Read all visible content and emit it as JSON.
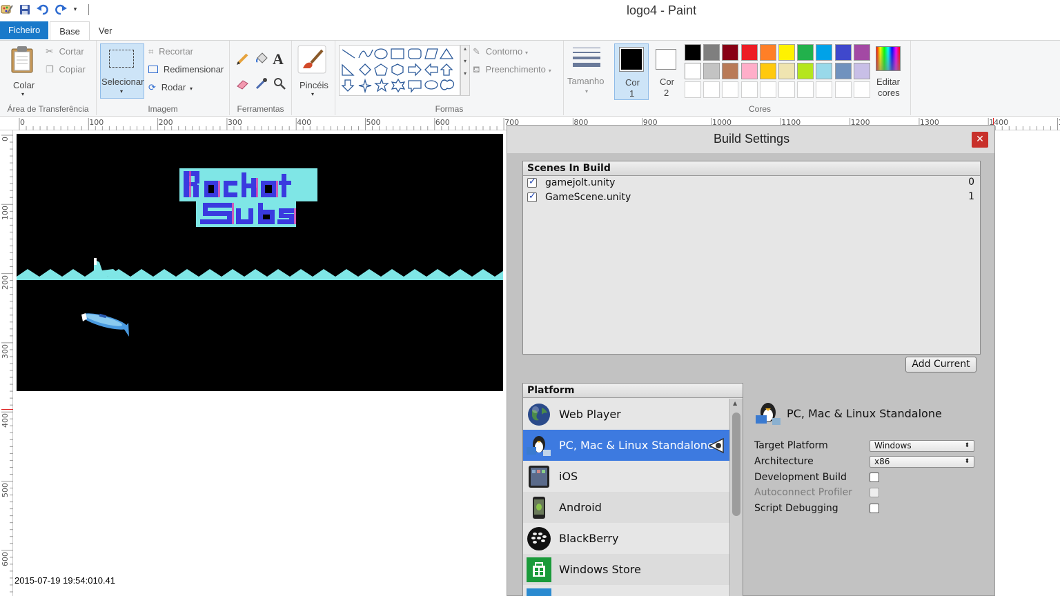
{
  "window": {
    "title": "logo4 - Paint"
  },
  "tabs": {
    "file": "Ficheiro",
    "home": "Base",
    "view": "Ver"
  },
  "ribbon": {
    "clipboard": {
      "paste": "Colar",
      "cut": "Cortar",
      "copy": "Copiar",
      "label": "Área de Transferência"
    },
    "image": {
      "select": "Selecionar",
      "crop": "Recortar",
      "resize": "Redimensionar",
      "rotate": "Rodar",
      "label": "Imagem"
    },
    "tools": {
      "label": "Ferramentas"
    },
    "brushes": {
      "label": "Pincéis"
    },
    "shapes": {
      "outline": "Contorno",
      "fill": "Preenchimento",
      "label": "Formas"
    },
    "size": {
      "label": "Tamanho"
    },
    "color1": {
      "label": "Cor",
      "num": "1",
      "value": "#000000"
    },
    "color2": {
      "label": "Cor",
      "num": "2",
      "value": "#ffffff"
    },
    "colors": {
      "label": "Cores",
      "row1": [
        "#000000",
        "#7f7f7f",
        "#880015",
        "#ed1c24",
        "#ff7f27",
        "#fff200",
        "#22b14c",
        "#00a2e8",
        "#3f48cc",
        "#a349a4"
      ],
      "row2": [
        "#ffffff",
        "#c3c3c3",
        "#b97a57",
        "#ffaec9",
        "#ffc90e",
        "#efe4b0",
        "#b5e61d",
        "#99d9ea",
        "#7092be",
        "#c8bfe7"
      ]
    },
    "edit_colors": {
      "line1": "Editar",
      "line2": "cores"
    }
  },
  "ruler": {
    "h": [
      "0",
      "100",
      "200",
      "300",
      "400",
      "500",
      "600",
      "700",
      "800",
      "900",
      "1000",
      "1100",
      "1200",
      "1300",
      "1400",
      "15"
    ],
    "v": [
      "0",
      "100",
      "200",
      "300",
      "400",
      "500",
      "600"
    ]
  },
  "canvas": {
    "timestamp": "2015-07-19 19:54:010.41"
  },
  "build_settings": {
    "title": "Build Settings",
    "close": "✕",
    "scenes_header": "Scenes In Build",
    "scenes": [
      {
        "name": "gamejolt.unity",
        "index": "0",
        "checked": true
      },
      {
        "name": "GameScene.unity",
        "index": "1",
        "checked": true
      }
    ],
    "add_current": "Add Current",
    "platform_header": "Platform",
    "platforms": [
      {
        "name": "Web Player",
        "icon": "globe-icon",
        "selected": false
      },
      {
        "name": "PC, Mac & Linux Standalone",
        "icon": "penguin-icon",
        "selected": true
      },
      {
        "name": "iOS",
        "icon": "ipad-icon",
        "selected": false
      },
      {
        "name": "Android",
        "icon": "android-phone-icon",
        "selected": false
      },
      {
        "name": "BlackBerry",
        "icon": "blackberry-icon",
        "selected": false
      },
      {
        "name": "Windows Store",
        "icon": "windows-store-icon",
        "selected": false
      }
    ],
    "details": {
      "title": "PC, Mac & Linux Standalone",
      "target_platform_label": "Target Platform",
      "target_platform_value": "Windows",
      "architecture_label": "Architecture",
      "architecture_value": "x86",
      "development_build_label": "Development Build",
      "autoconnect_profiler_label": "Autoconnect Profiler",
      "script_debugging_label": "Script Debugging"
    }
  }
}
